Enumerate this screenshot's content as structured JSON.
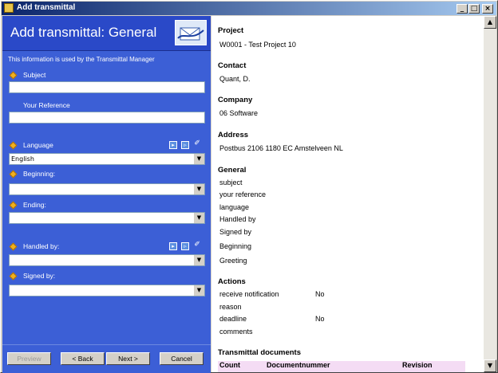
{
  "window": {
    "title": "Add transmittal"
  },
  "titlebar_buttons": {
    "minimize": "_",
    "maximize": "□",
    "close": "×"
  },
  "left": {
    "heading": "Add transmittal: General",
    "intro": "This information is used by the Transmittal Manager",
    "fields": {
      "subject": {
        "label": "Subject",
        "value": ""
      },
      "reference": {
        "label": "Your Reference",
        "value": ""
      },
      "language": {
        "label": "Language",
        "value": "English"
      },
      "beginning": {
        "label": "Beginning:",
        "value": ""
      },
      "ending": {
        "label": "Ending:",
        "value": ""
      },
      "handled_by": {
        "label": "Handled by:",
        "value": ""
      },
      "signed_by": {
        "label": "Signed by:",
        "value": ""
      }
    },
    "buttons": {
      "preview": "Preview",
      "back": "< Back",
      "next": "Next >",
      "cancel": "Cancel"
    }
  },
  "right": {
    "project": {
      "label": "Project",
      "value": "W0001 - Test Project 10"
    },
    "contact": {
      "label": "Contact",
      "value": "Quant, D."
    },
    "company": {
      "label": "Company",
      "value": "06 Software"
    },
    "address": {
      "label": "Address",
      "value": "Postbus 2106 1180 EC Amstelveen NL"
    },
    "general": {
      "label": "General",
      "items": [
        "subject",
        "your reference",
        "language",
        "Handled by",
        "Signed by",
        "Beginning",
        "Greeting"
      ]
    },
    "actions": {
      "label": "Actions",
      "rows": [
        {
          "name": "receive notification",
          "value": "No"
        },
        {
          "name": "reason",
          "value": ""
        },
        {
          "name": "deadline",
          "value": "No"
        },
        {
          "name": "comments",
          "value": ""
        }
      ]
    },
    "documents": {
      "label": "Transmittal documents",
      "columns": [
        "Count",
        "Documentnummer",
        "Revision"
      ]
    }
  },
  "colors": {
    "panel": "#3c5fd6",
    "header": "#2a49c8",
    "table_header": "#f4dcf4"
  }
}
